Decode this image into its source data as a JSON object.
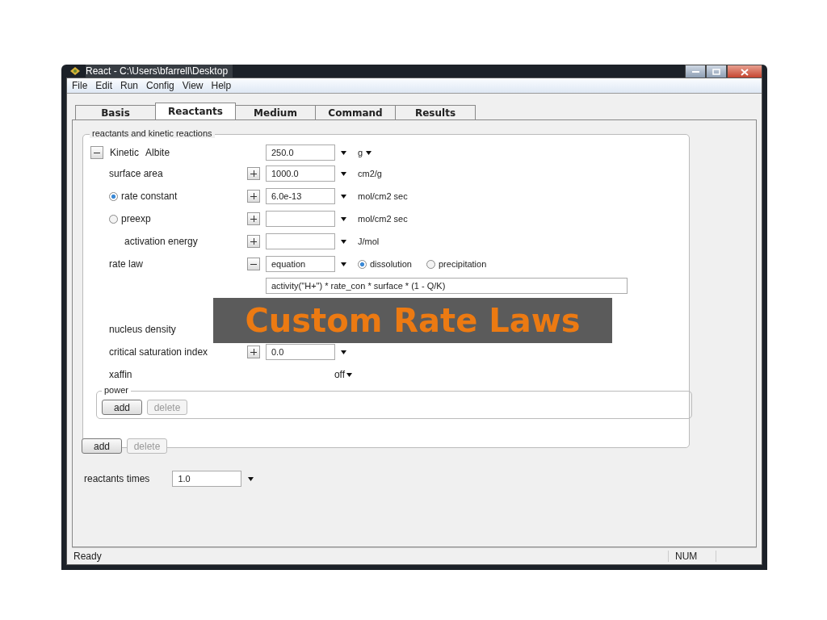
{
  "window": {
    "title": "React - C:\\Users\\bfarrell\\Desktop"
  },
  "menu": [
    "File",
    "Edit",
    "Run",
    "Config",
    "View",
    "Help"
  ],
  "tabs": [
    {
      "label": "Basis",
      "selected": false
    },
    {
      "label": "Reactants",
      "selected": true
    },
    {
      "label": "Medium",
      "selected": false
    },
    {
      "label": "Command",
      "selected": false
    },
    {
      "label": "Results",
      "selected": false
    }
  ],
  "reactants_group": {
    "title": "reactants and kinetic reactions",
    "reactant": {
      "expanded": true,
      "type": "Kinetic",
      "name": "Albite",
      "amount": "250.0",
      "unit": "g"
    },
    "rows": [
      {
        "kind": "field",
        "label": "surface area",
        "expanded": false,
        "value": "1000.0",
        "unit": "cm2/g"
      },
      {
        "kind": "radio",
        "label": "rate constant",
        "selected": true,
        "expanded": false,
        "value": "6.0e-13",
        "unit": "mol/cm2 sec"
      },
      {
        "kind": "radio",
        "label": "preexp",
        "selected": false,
        "expanded": false,
        "unit": "mol/cm2 sec",
        "children": [
          {
            "kind": "field",
            "label": "activation energy",
            "expanded": false,
            "unit": "J/mol"
          }
        ]
      },
      {
        "kind": "ratelaw",
        "label": "rate law",
        "expanded": true,
        "value": "equation",
        "options": [
          {
            "label": "dissolution",
            "selected": true
          },
          {
            "label": "precipitation",
            "selected": false
          }
        ]
      },
      {
        "kind": "formula",
        "value": "activity(\"H+\") * rate_con * surface * (1 - Q/K)"
      },
      {
        "kind": "blank"
      },
      {
        "kind": "label",
        "label": "nucleus density"
      },
      {
        "kind": "field",
        "label": "critical saturation index",
        "expanded": false,
        "value": "0.0"
      },
      {
        "kind": "select",
        "label": "xaffin",
        "value": "off"
      }
    ],
    "power": {
      "title": "power",
      "buttons": [
        {
          "label": "add",
          "disabled": false
        },
        {
          "label": "delete",
          "disabled": true
        }
      ]
    },
    "buttons": [
      {
        "label": "add",
        "disabled": false
      },
      {
        "label": "delete",
        "disabled": true
      }
    ]
  },
  "reactants_times": {
    "label": "reactants times",
    "value": "1.0"
  },
  "status_bar": {
    "message": "Ready",
    "indicator": "NUM"
  },
  "banner": "Custom Rate Laws"
}
